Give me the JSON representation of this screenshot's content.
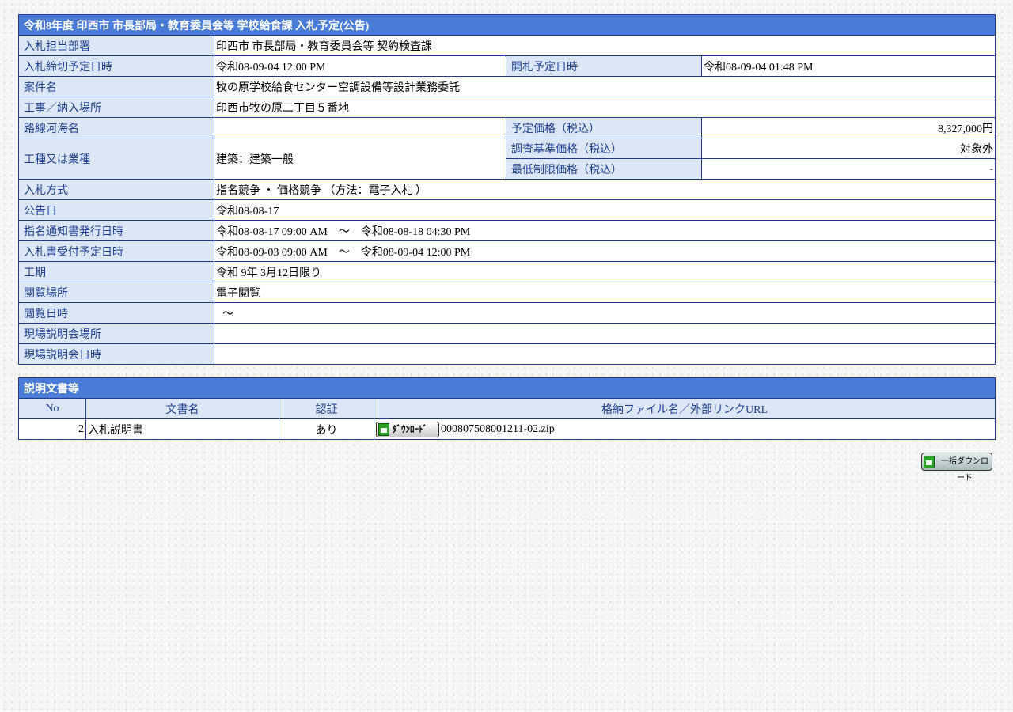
{
  "bid": {
    "title": "令和8年度 印西市 市長部局・教育委員会等 学校給食課 入札予定(公告)",
    "rows": {
      "department": {
        "label": "入札担当部署",
        "value": "印西市 市長部局・教育委員会等 契約検査課"
      },
      "deadline": {
        "label": "入札締切予定日時",
        "value": "令和08-09-04 12:00 PM"
      },
      "opening": {
        "label": "開札予定日時",
        "value": "令和08-09-04 01:48 PM"
      },
      "project_name": {
        "label": "案件名",
        "value": "牧の原学校給食センター空調設備等設計業務委託"
      },
      "location": {
        "label": "工事／納入場所",
        "value": "印西市牧の原二丁目５番地"
      },
      "route": {
        "label": "路線河海名",
        "value": ""
      },
      "planned_price": {
        "label": "予定価格（税込）",
        "value": "8,327,000円"
      },
      "category": {
        "label": "工種又は業種",
        "value": "建築：建築一般"
      },
      "survey_price": {
        "label": "調査基準価格（税込）",
        "value": "対象外"
      },
      "min_price": {
        "label": "最低制限価格（税込）",
        "value": "-"
      },
      "method": {
        "label": "入札方式",
        "value": "指名競争 ・ 価格競争 （方法：電子入札 ）"
      },
      "notice_date": {
        "label": "公告日",
        "value": "令和08-08-17"
      },
      "notification": {
        "label": "指名通知書発行日時",
        "value": "令和08-08-17 09:00 AM　～　令和08-08-18 04:30 PM"
      },
      "acceptance": {
        "label": "入札書受付予定日時",
        "value": "令和08-09-03 09:00 AM　～　令和08-09-04 12:00 PM"
      },
      "period": {
        "label": "工期",
        "value": "令和 9年 3月12日限り"
      },
      "viewing_place": {
        "label": "閲覧場所",
        "value": "電子閲覧"
      },
      "viewing_datetime": {
        "label": "閲覧日時",
        "value": "～"
      },
      "site_place": {
        "label": "現場説明会場所",
        "value": ""
      },
      "site_datetime": {
        "label": "現場説明会日時",
        "value": ""
      }
    }
  },
  "docs": {
    "title": "説明文書等",
    "headers": {
      "no": "No",
      "name": "文書名",
      "auth": "認証",
      "file": "格納ファイル名／外部リンクURL"
    },
    "rows": [
      {
        "no": "2",
        "name": "入札説明書",
        "auth": "あり",
        "button_label": "ﾀﾞｳﾝﾛｰﾄﾞ",
        "file": "000807508001211-02.zip"
      }
    ]
  },
  "bulk_download": {
    "label": "一括ダウンロード"
  },
  "colors": {
    "header_bg": "#4a7bd6",
    "label_bg": "#dbe7f6",
    "label_text": "#1f3f8f",
    "border": "#1f3a8a"
  },
  "icons": {
    "download": "floppy-disk-download-icon"
  }
}
